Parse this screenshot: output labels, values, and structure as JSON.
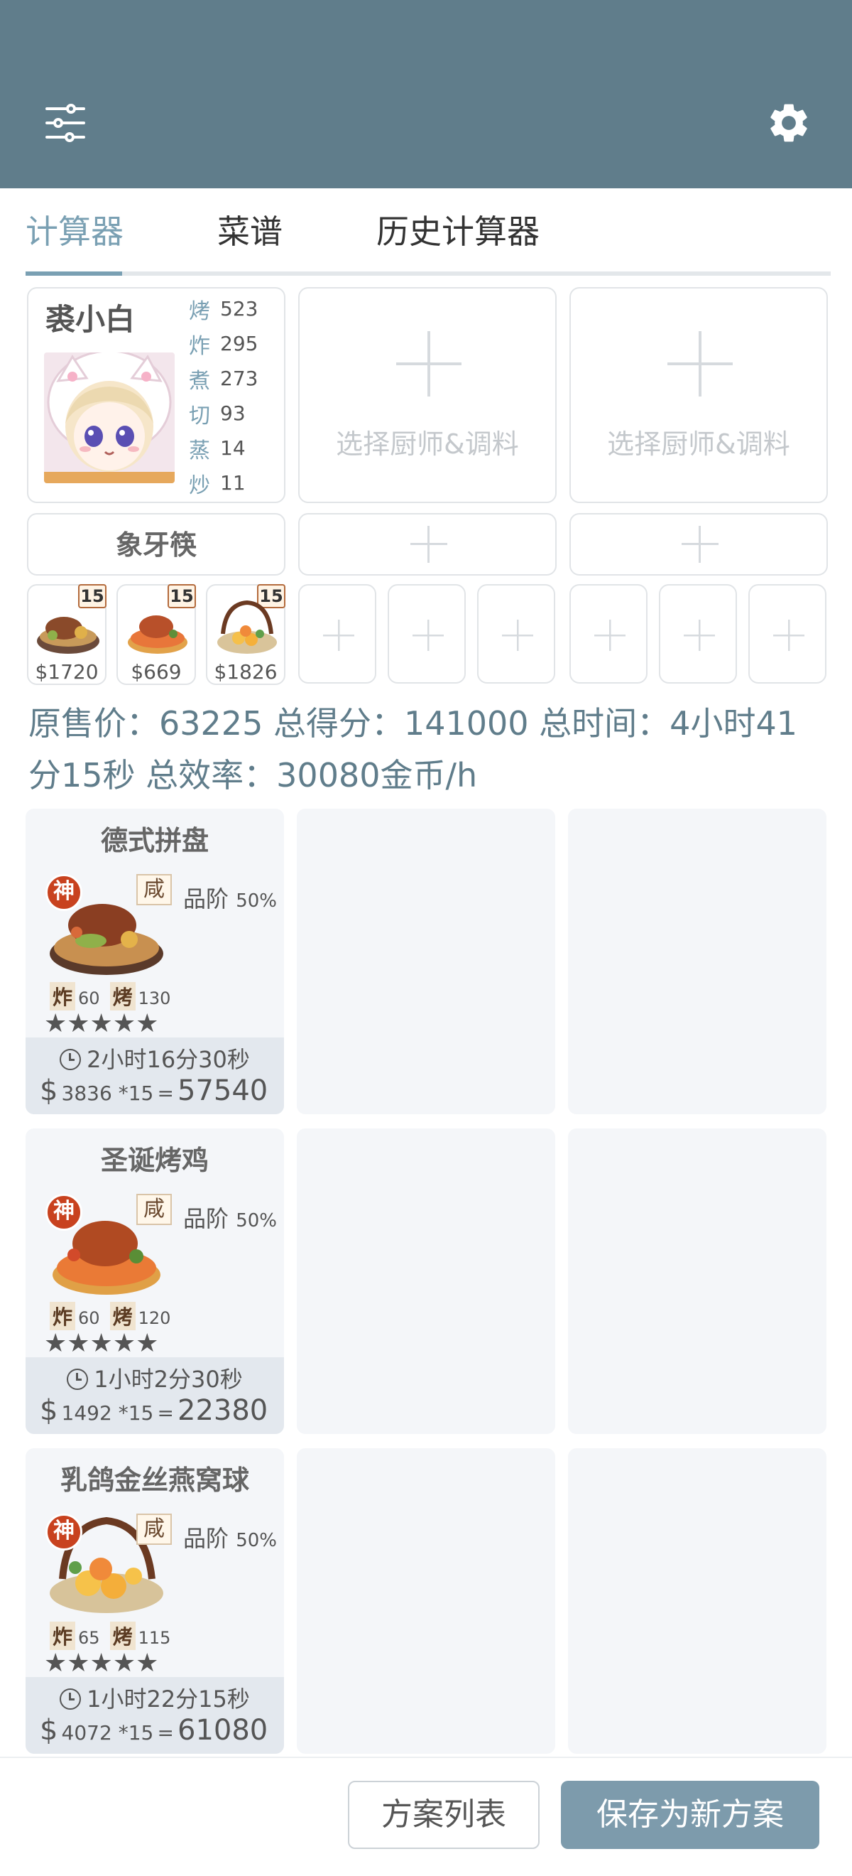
{
  "header": {
    "menu_icon": "sliders-icon",
    "settings_icon": "gear-icon",
    "bg_color": "#607d8b"
  },
  "tabs": [
    {
      "label": "计算器",
      "active": true
    },
    {
      "label": "菜谱",
      "active": false
    },
    {
      "label": "历史计算器",
      "active": false
    }
  ],
  "chef": {
    "name": "裘小白",
    "skills": [
      {
        "k": "烤",
        "v": "523"
      },
      {
        "k": "炸",
        "v": "295"
      },
      {
        "k": "煮",
        "v": "273"
      },
      {
        "k": "切",
        "v": "93"
      },
      {
        "k": "蒸",
        "v": "14"
      },
      {
        "k": "炒",
        "v": "11"
      }
    ]
  },
  "chef_slots": {
    "empty_label": "选择厨师&调料"
  },
  "utensil": {
    "name": "象牙筷"
  },
  "dish_thumbs": [
    {
      "qty": "15",
      "price": "$1720"
    },
    {
      "qty": "15",
      "price": "$669"
    },
    {
      "qty": "15",
      "price": "$1826"
    }
  ],
  "summary": {
    "line1": "原售价：63225 总得分：141000 总时间：4小时41",
    "line2": "分15秒 总效率：30080金币/h"
  },
  "recipes": [
    {
      "name": "德式拼盘",
      "badge": "神",
      "flavor": "咸",
      "grade_label": "品阶",
      "grade_pct": "50%",
      "skills": [
        {
          "k": "炸",
          "v": "60"
        },
        {
          "k": "烤",
          "v": "130"
        }
      ],
      "stars": "★★★★★",
      "time": "2小时16分30秒",
      "dollar": "$",
      "formula": "3836 *15",
      "eq": "=",
      "total": "57540"
    },
    {
      "name": "圣诞烤鸡",
      "badge": "神",
      "flavor": "咸",
      "grade_label": "品阶",
      "grade_pct": "50%",
      "skills": [
        {
          "k": "炸",
          "v": "60"
        },
        {
          "k": "烤",
          "v": "120"
        }
      ],
      "stars": "★★★★★",
      "time": "1小时2分30秒",
      "dollar": "$",
      "formula": "1492 *15",
      "eq": "=",
      "total": "22380"
    },
    {
      "name": "乳鸽金丝燕窝球",
      "badge": "神",
      "flavor": "咸",
      "grade_label": "品阶",
      "grade_pct": "50%",
      "skills": [
        {
          "k": "炸",
          "v": "65"
        },
        {
          "k": "烤",
          "v": "115"
        }
      ],
      "stars": "★★★★★",
      "time": "1小时22分15秒",
      "dollar": "$",
      "formula": "4072 *15",
      "eq": "=",
      "total": "61080"
    }
  ],
  "footer": {
    "list_label": "方案列表",
    "save_label": "保存为新方案"
  },
  "colors": {
    "accent": "#7aa0b3",
    "primary_button": "#7d9bac",
    "god_badge": "#c8421f"
  }
}
